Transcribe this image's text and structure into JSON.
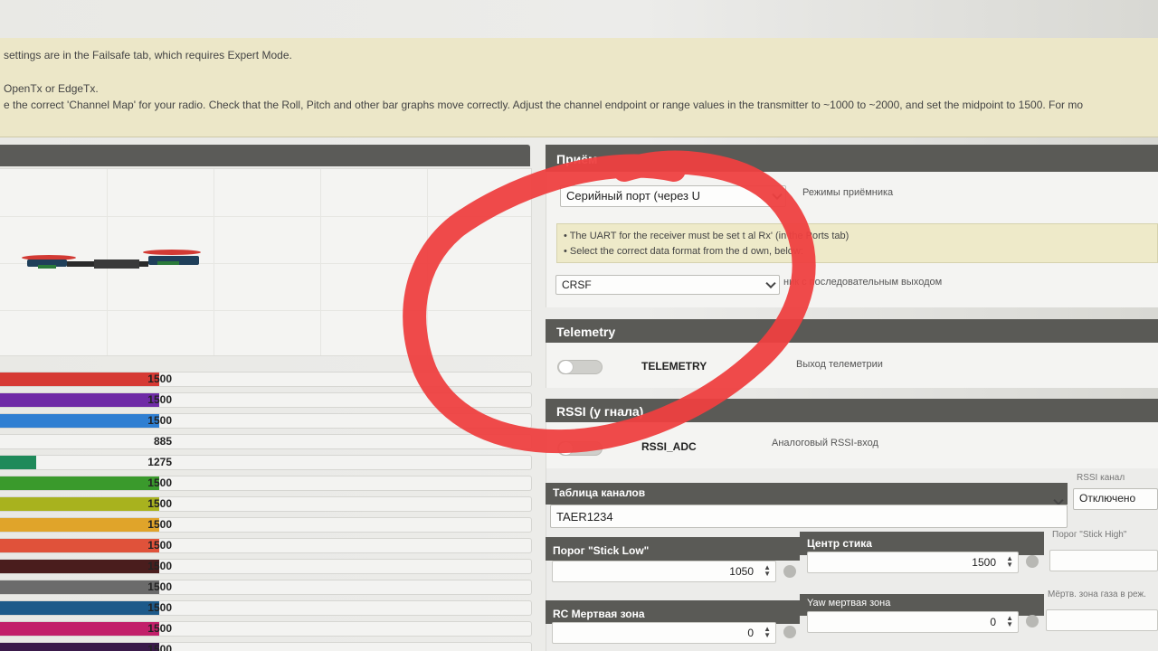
{
  "note": {
    "line1": "settings are in the Failsafe tab, which requires Expert Mode.",
    "line2": "OpenTx or EdgeTx.",
    "line3": "e the correct 'Channel Map' for your radio. Check that the Roll, Pitch and other bar graphs move correctly. Adjust the channel endpoint or range values in the transmitter to ~1000 to ~2000, and set the midpoint to 1500. For mo"
  },
  "channels": [
    {
      "value": "1500",
      "fraction": 0.5,
      "color": "#d63a34"
    },
    {
      "value": "1500",
      "fraction": 0.5,
      "color": "#6f2aa6"
    },
    {
      "value": "1500",
      "fraction": 0.5,
      "color": "#2f7fd2"
    },
    {
      "value": "885",
      "fraction": 0.0,
      "color": "#2f9a6a"
    },
    {
      "value": "1275",
      "fraction": 0.07,
      "color": "#1f8a5a"
    },
    {
      "value": "1500",
      "fraction": 0.5,
      "color": "#3a9a2c"
    },
    {
      "value": "1500",
      "fraction": 0.5,
      "color": "#a8b21e"
    },
    {
      "value": "1500",
      "fraction": 0.5,
      "color": "#e0a42a"
    },
    {
      "value": "1500",
      "fraction": 0.5,
      "color": "#e0523a"
    },
    {
      "value": "1500",
      "fraction": 0.5,
      "color": "#4a1d1d"
    },
    {
      "value": "1500",
      "fraction": 0.5,
      "color": "#6b6b6b"
    },
    {
      "value": "1500",
      "fraction": 0.5,
      "color": "#1d5a8a"
    },
    {
      "value": "1500",
      "fraction": 0.5,
      "color": "#c21f6a"
    },
    {
      "value": "1500",
      "fraction": 0.5,
      "color": "#3a1a4a"
    }
  ],
  "receiver": {
    "header": "Приём",
    "mode_select": "Серийный порт (через U",
    "mode_label": "Режимы приёмника",
    "uart_note_1": "• The UART for the receiver must be set t          al Rx' (in the Ports tab)",
    "uart_note_2": "• Select the correct data format from the d        own, below:",
    "provider_select": "CRSF",
    "provider_label": "ник с последовательным выходом"
  },
  "telemetry": {
    "header": "Telemetry",
    "feature": "TELEMETRY",
    "description": "Выход телеметрии",
    "enabled": false
  },
  "rssi": {
    "header": "RSSI (у          гнала)",
    "feature": "RSSI_ADC",
    "description": "Аналоговый RSSI-вход",
    "enabled": false
  },
  "channel_map": {
    "label": "Таблица каналов",
    "value": "TAER1234",
    "rssi_channel_label": "RSSI канал",
    "rssi_channel_value": "Отключено"
  },
  "stick": {
    "low_label": "Порог \"Stick Low\"",
    "low_value": "1050",
    "center_label": "Центр стика",
    "center_value": "1500",
    "high_label": "Порог \"Stick High\""
  },
  "deadband": {
    "rc_label": "RC Мертвая зона",
    "rc_value": "0",
    "yaw_label": "Yaw мертвая зона",
    "yaw_value": "0",
    "throttle_label": "Мёртв. зона газа в реж."
  },
  "colors": {
    "header_bg": "#5a5a56",
    "note_bg": "#ece7c8",
    "annotation_ring": "#ee4040"
  }
}
